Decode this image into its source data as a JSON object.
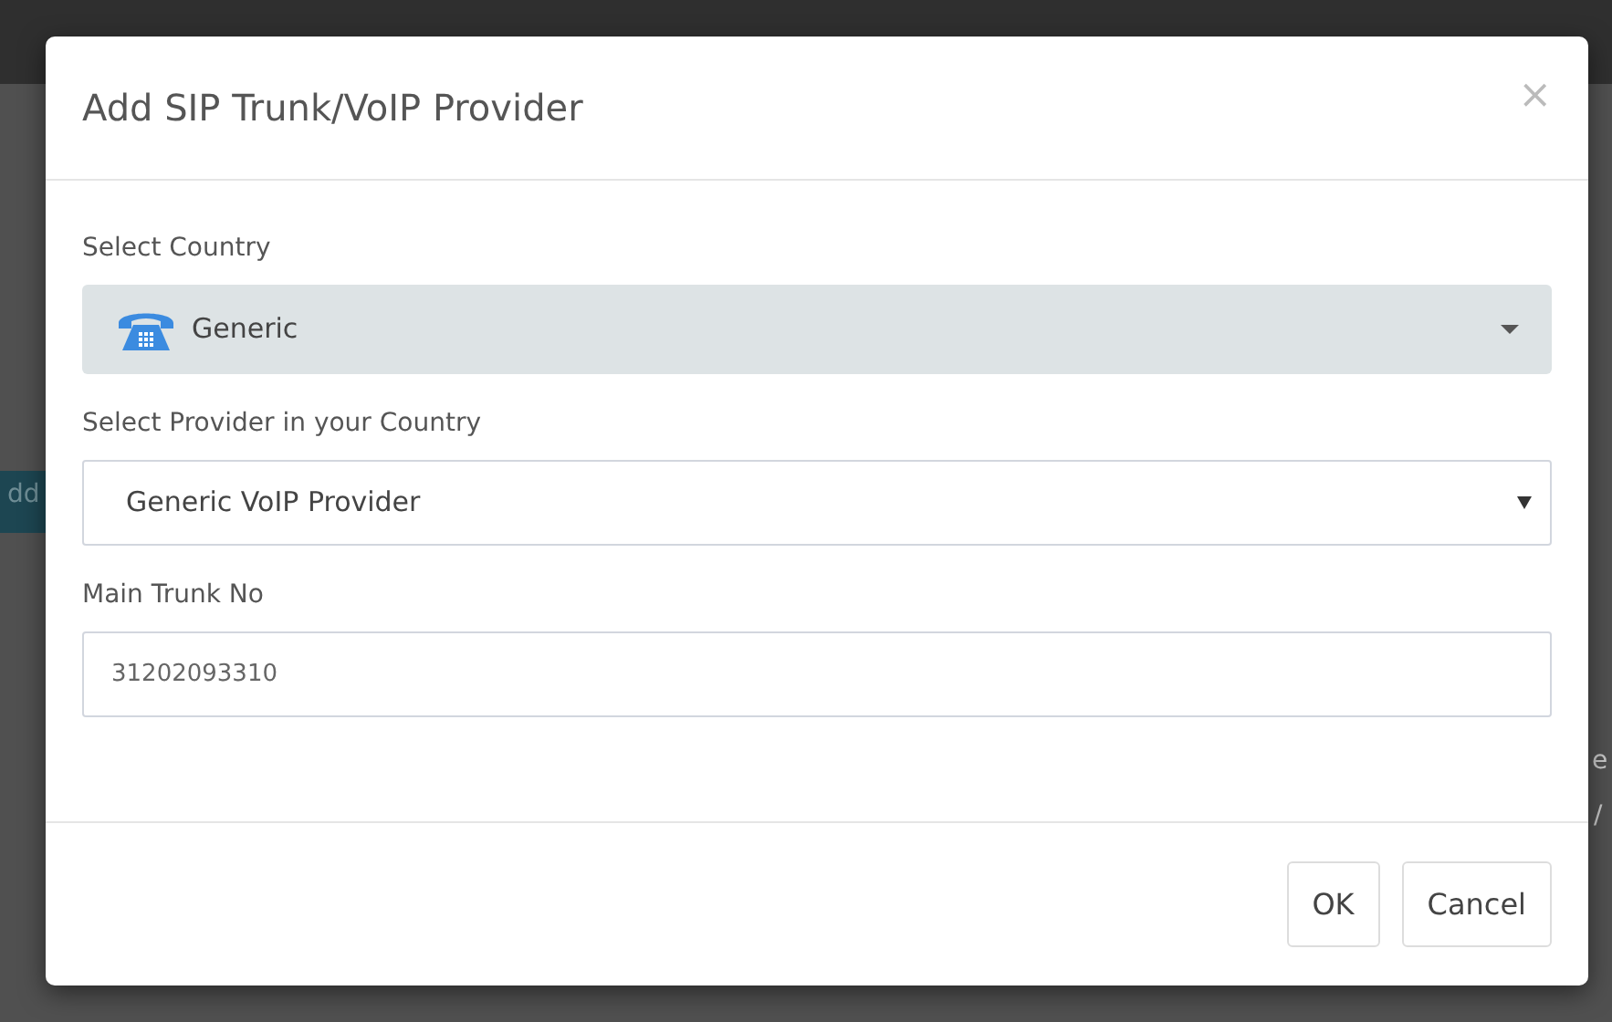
{
  "background": {
    "fragments": [
      {
        "kind": "button",
        "text": "dd"
      },
      {
        "kind": "text",
        "text": "e"
      },
      {
        "kind": "text",
        "text": "/"
      }
    ]
  },
  "modal": {
    "title": "Add SIP Trunk/VoIP Provider",
    "close": "×",
    "fields": [
      {
        "kind": "country",
        "label": "Select Country",
        "value": "Generic"
      },
      {
        "kind": "select",
        "label": "Select Provider in your Country",
        "value": "Generic VoIP Provider"
      },
      {
        "kind": "input",
        "label": "Main Trunk No",
        "value": "31202093310"
      }
    ],
    "buttons": [
      {
        "label": "OK"
      },
      {
        "label": "Cancel"
      }
    ]
  }
}
